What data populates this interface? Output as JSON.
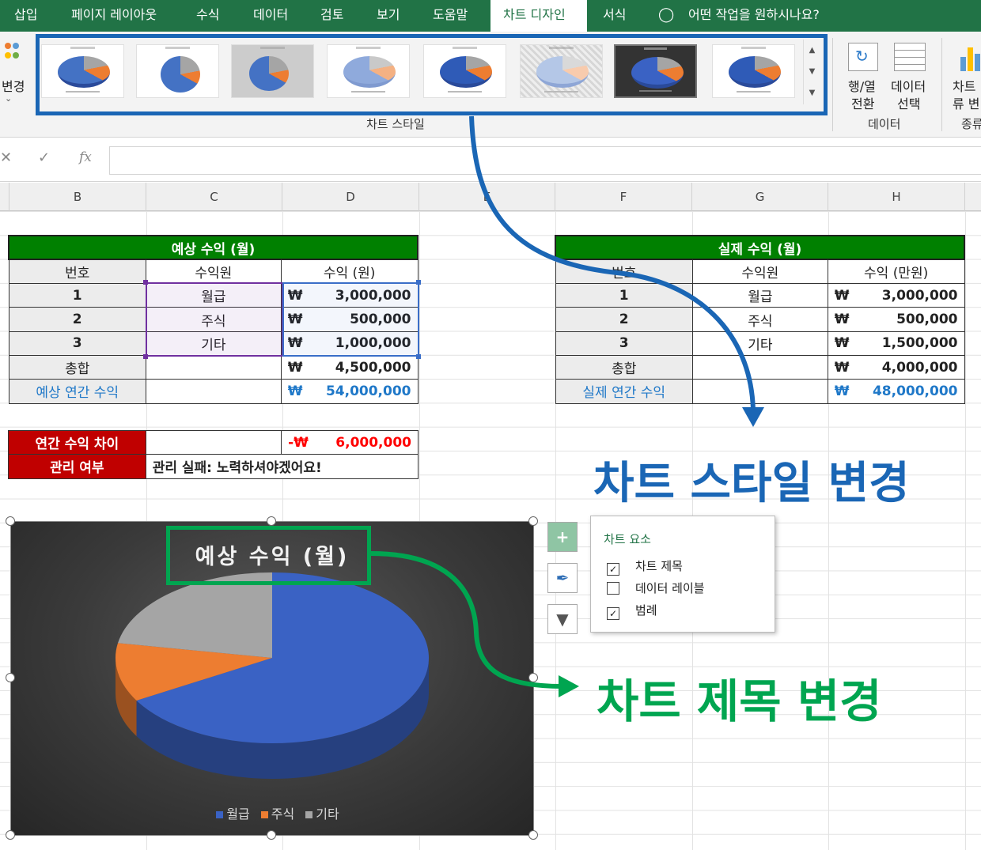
{
  "ribbon": {
    "tabs": [
      "삽입",
      "페이지 레이아웃",
      "수식",
      "데이터",
      "검토",
      "보기",
      "도움말",
      "차트 디자인",
      "서식"
    ],
    "tell_me": "어떤 작업을 원하시나요?",
    "change_label": "변경",
    "styles_group": "차트 스타일",
    "data_group": "데이터",
    "switch_row_col_1": "행/열",
    "switch_row_col_2": "전환",
    "select_data_1": "데이터",
    "select_data_2": "선택",
    "change_type_1": "차트",
    "change_type_2": "류 변",
    "type_group": "종류",
    "gallery_count": 8,
    "selected_style_index": 7
  },
  "formula_bar": {
    "fx": "fx",
    "cancel": "✕",
    "enter": "✓",
    "value": ""
  },
  "columns": [
    "B",
    "C",
    "D",
    "E",
    "F",
    "G",
    "H"
  ],
  "expected": {
    "title": "예상 수익 (월)",
    "headers": [
      "번호",
      "수익원",
      "수익 (원)"
    ],
    "rows": [
      {
        "no": "1",
        "source": "월급",
        "cur": "₩",
        "amount": "3,000,000"
      },
      {
        "no": "2",
        "source": "주식",
        "cur": "₩",
        "amount": "500,000"
      },
      {
        "no": "3",
        "source": "기타",
        "cur": "₩",
        "amount": "1,000,000"
      }
    ],
    "total_label": "총합",
    "total_cur": "₩",
    "total": "4,500,000",
    "annual_label": "예상 연간 수익",
    "annual_cur": "₩",
    "annual": "54,000,000"
  },
  "actual": {
    "title": "실제 수익 (월)",
    "headers": [
      "번호",
      "수익원",
      "수익 (만원)"
    ],
    "rows": [
      {
        "no": "1",
        "source": "월급",
        "cur": "₩",
        "amount": "3,000,000"
      },
      {
        "no": "2",
        "source": "주식",
        "cur": "₩",
        "amount": "500,000"
      },
      {
        "no": "3",
        "source": "기타",
        "cur": "₩",
        "amount": "1,500,000"
      }
    ],
    "total_label": "총합",
    "total_cur": "₩",
    "total": "4,000,000",
    "annual_label": "실제 연간 수익",
    "annual_cur": "₩",
    "annual": "48,000,000"
  },
  "summary": {
    "diff_label": "연간 수익 차이",
    "diff_cur": "-₩",
    "diff_value": "6,000,000",
    "manage_label": "관리 여부",
    "manage_value": "관리 실패: 노력하셔야겠어요!"
  },
  "chart_data": {
    "type": "pie",
    "title": "예상 수익 (월)",
    "categories": [
      "월급",
      "주식",
      "기타"
    ],
    "values": [
      3000000,
      500000,
      1000000
    ],
    "colors": [
      "#3a62c4",
      "#ed7d31",
      "#a5a5a5"
    ],
    "legend_position": "bottom"
  },
  "chart_elements": {
    "title": "차트 요소",
    "items": [
      {
        "label": "차트 제목",
        "checked": true
      },
      {
        "label": "데이터 레이블",
        "checked": false
      },
      {
        "label": "범례",
        "checked": true
      }
    ],
    "plus": "+"
  },
  "callouts": {
    "style_change": "차트 스타일 변경",
    "title_change": "차트 제목 변경",
    "style_color": "#1a66b5",
    "title_color": "#00a550"
  }
}
